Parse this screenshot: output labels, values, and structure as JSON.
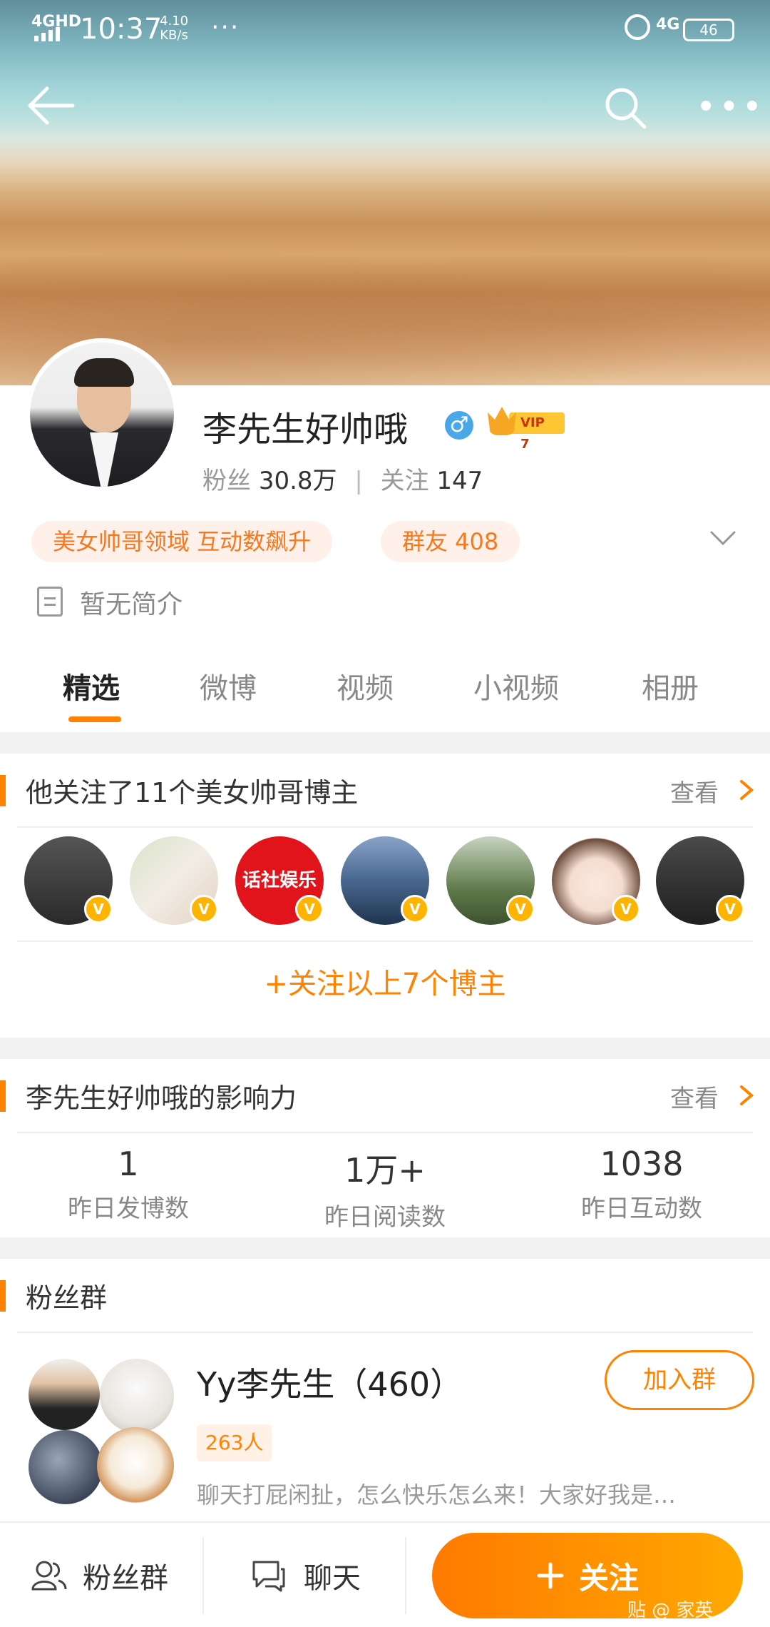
{
  "status_bar": {
    "network": "4GHD",
    "time": "10:37",
    "speed_value": "4.10",
    "speed_unit": "KB/s",
    "network_right": "4G",
    "battery": "46"
  },
  "profile": {
    "name": "李先生好帅哦",
    "vip_label": "VIP 7",
    "gender_symbol": "♂",
    "fans_label": "粉丝",
    "fans_value": "30.8万",
    "following_label": "关注",
    "following_value": "147",
    "chip_field": "美女帅哥领域 互动数飙升",
    "chip_group": "群友 408",
    "intro": "暂无简介"
  },
  "tabs": [
    "精选",
    "微博",
    "视频",
    "小视频",
    "相册"
  ],
  "following_card": {
    "title": "他关注了11个美女帅哥博主",
    "more": "查看",
    "follow_all": "+关注以上7个博主",
    "avatar_badge": "V",
    "avatar_colors": [
      "#3a3a3a",
      "#e8e2da",
      "#e0141a",
      "#5d7fa8",
      "#6f8a5a",
      "#f2e6e0",
      "#2b2b2b"
    ],
    "logo_text": "话社娱乐"
  },
  "influence_card": {
    "title": "李先生好帅哦的影响力",
    "more": "查看",
    "stats": [
      {
        "value": "1",
        "label": "昨日发博数"
      },
      {
        "value": "1万+",
        "label": "昨日阅读数"
      },
      {
        "value": "1038",
        "label": "昨日互动数"
      }
    ]
  },
  "fans_group_card": {
    "title": "粉丝群",
    "group_name": "Yy李先生（460）",
    "join_label": "加入群",
    "members": "263人",
    "description": "聊天打屁闲扯，怎么快乐怎么来！大家好我是…"
  },
  "bottom_bar": {
    "fans_group": "粉丝群",
    "chat": "聊天",
    "follow": "关注"
  },
  "watermark": "贴 @ 家英"
}
